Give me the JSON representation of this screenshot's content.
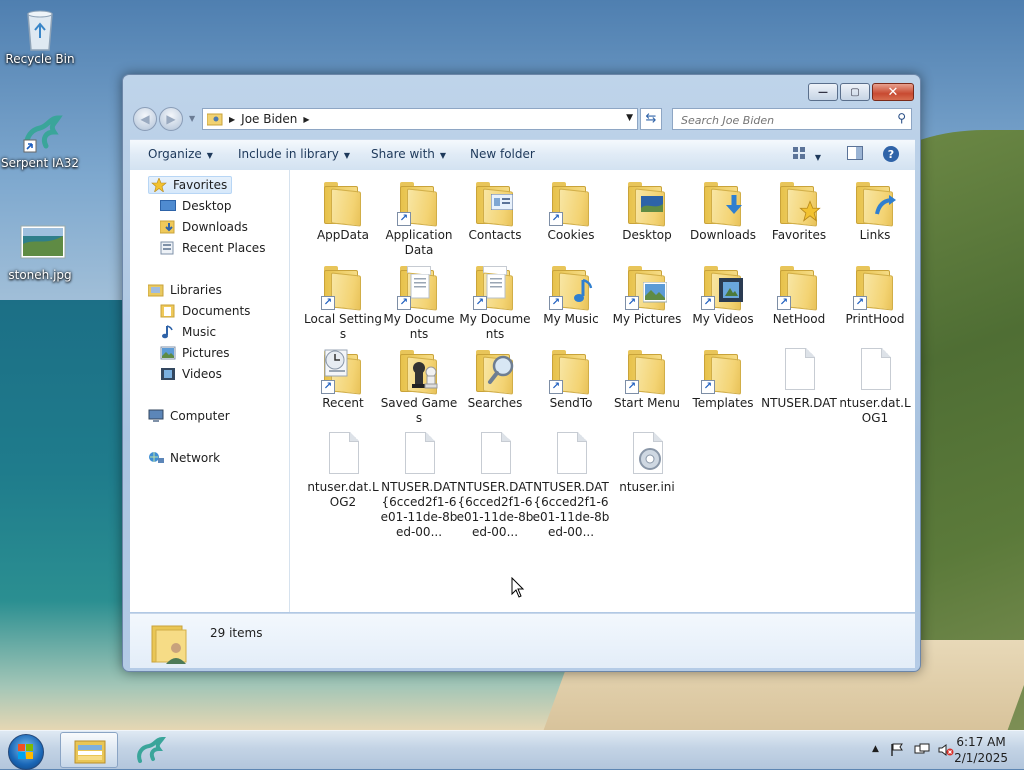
{
  "desktop": {
    "icons": [
      {
        "label": "Recycle Bin",
        "icon": "recycle-bin-icon"
      },
      {
        "label": "Serpent IA32",
        "icon": "serpent-dragon-icon"
      },
      {
        "label": "stoneh.jpg",
        "icon": "image-file-icon"
      }
    ]
  },
  "window": {
    "title": "Joe Biden",
    "caption_buttons": {
      "minimize": "—",
      "maximize": "▢",
      "close": "✕"
    },
    "address": {
      "crumbs": [
        "Joe Biden"
      ]
    },
    "search": {
      "placeholder": "Search Joe Biden"
    },
    "toolbar": {
      "organize": "Organize",
      "include_in_library": "Include in library",
      "share_with": "Share with",
      "new_folder": "New folder"
    },
    "nav": {
      "favorites": "Favorites",
      "desktop": "Desktop",
      "downloads": "Downloads",
      "recent_places": "Recent Places",
      "libraries": "Libraries",
      "documents": "Documents",
      "music": "Music",
      "pictures": "Pictures",
      "videos": "Videos",
      "computer": "Computer",
      "network": "Network"
    },
    "files": [
      {
        "name": "AppData",
        "type": "folder",
        "shortcut": false,
        "overlay": "none"
      },
      {
        "name": "Application Data",
        "type": "folder",
        "shortcut": true,
        "overlay": "none"
      },
      {
        "name": "Contacts",
        "type": "folder",
        "shortcut": false,
        "overlay": "contacts"
      },
      {
        "name": "Cookies",
        "type": "folder",
        "shortcut": true,
        "overlay": "none"
      },
      {
        "name": "Desktop",
        "type": "folder",
        "shortcut": false,
        "overlay": "desktop"
      },
      {
        "name": "Downloads",
        "type": "folder",
        "shortcut": false,
        "overlay": "download"
      },
      {
        "name": "Favorites",
        "type": "folder",
        "shortcut": false,
        "overlay": "star"
      },
      {
        "name": "Links",
        "type": "folder",
        "shortcut": false,
        "overlay": "link"
      },
      {
        "name": "Local Settings",
        "type": "folder",
        "shortcut": true,
        "overlay": "none"
      },
      {
        "name": "My Documents",
        "type": "folder",
        "shortcut": true,
        "overlay": "docs"
      },
      {
        "name": "My Documents",
        "type": "folder",
        "shortcut": true,
        "overlay": "docs"
      },
      {
        "name": "My Music",
        "type": "folder",
        "shortcut": true,
        "overlay": "music"
      },
      {
        "name": "My Pictures",
        "type": "folder",
        "shortcut": true,
        "overlay": "pictures"
      },
      {
        "name": "My Videos",
        "type": "folder",
        "shortcut": true,
        "overlay": "video"
      },
      {
        "name": "NetHood",
        "type": "folder",
        "shortcut": true,
        "overlay": "none"
      },
      {
        "name": "PrintHood",
        "type": "folder",
        "shortcut": true,
        "overlay": "none"
      },
      {
        "name": "Recent",
        "type": "folder",
        "shortcut": true,
        "overlay": "recent"
      },
      {
        "name": "Saved Games",
        "type": "folder",
        "shortcut": false,
        "overlay": "games"
      },
      {
        "name": "Searches",
        "type": "folder",
        "shortcut": false,
        "overlay": "search"
      },
      {
        "name": "SendTo",
        "type": "folder",
        "shortcut": true,
        "overlay": "none"
      },
      {
        "name": "Start Menu",
        "type": "folder",
        "shortcut": true,
        "overlay": "none"
      },
      {
        "name": "Templates",
        "type": "folder",
        "shortcut": true,
        "overlay": "none"
      },
      {
        "name": "NTUSER.DAT",
        "type": "file",
        "shortcut": false,
        "overlay": "none"
      },
      {
        "name": "ntuser.dat.LOG1",
        "type": "file",
        "shortcut": false,
        "overlay": "none"
      },
      {
        "name": "ntuser.dat.LOG2",
        "type": "file",
        "shortcut": false,
        "overlay": "none"
      },
      {
        "name": "NTUSER.DAT{6cced2f1-6e01-11de-8bed-00...",
        "type": "file",
        "shortcut": false,
        "overlay": "none"
      },
      {
        "name": "NTUSER.DAT{6cced2f1-6e01-11de-8bed-00...",
        "type": "file",
        "shortcut": false,
        "overlay": "none"
      },
      {
        "name": "NTUSER.DAT{6cced2f1-6e01-11de-8bed-00...",
        "type": "file",
        "shortcut": false,
        "overlay": "none"
      },
      {
        "name": "ntuser.ini",
        "type": "file",
        "shortcut": false,
        "overlay": "settings"
      }
    ],
    "status": {
      "item_count": "29 items"
    }
  },
  "taskbar": {
    "apps": [
      "windows-explorer-icon",
      "serpent-dragon-icon"
    ],
    "clock": {
      "time": "6:17 AM",
      "date": "2/1/2025"
    }
  },
  "colors": {
    "accent": "#2f63a8",
    "folder": "#f3d373",
    "selection": "#d6e8fa"
  }
}
